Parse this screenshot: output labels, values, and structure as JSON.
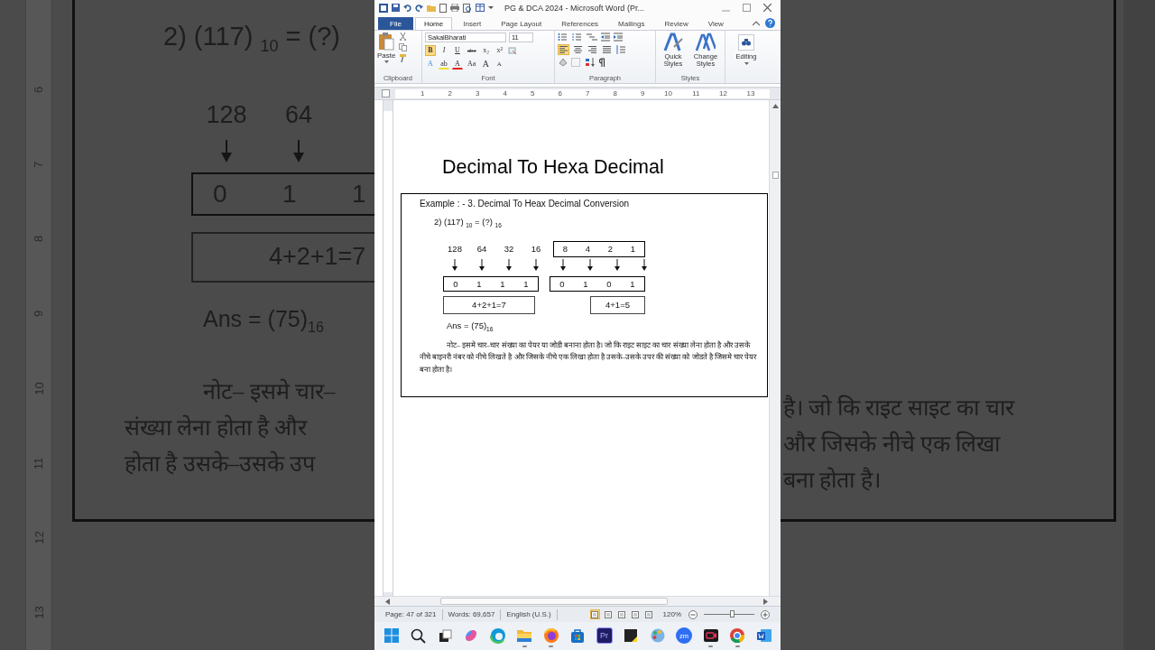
{
  "backdrop_left": {
    "ruler_labels": [
      "6",
      "7",
      "8",
      "9",
      "10",
      "11",
      "12",
      "13"
    ],
    "equation": "2)  (117) $_{10}$ = (?)",
    "weights": [
      "128",
      "64"
    ],
    "bits": [
      "0",
      "1",
      "1"
    ],
    "sum": "4+2+1=7",
    "answer": "Ans = (75)$_{16}$",
    "note_lines": [
      "नोट– इसमे चार–",
      "संख्या लेना होता है और",
      "होता है उसके–उसके उप"
    ]
  },
  "window": {
    "title": "PG & DCA 2024  -  Microsoft Word (Pr..."
  },
  "ribbon_tabs": [
    {
      "label": "File",
      "kind": "file",
      "selected": false
    },
    {
      "label": "Home",
      "kind": "tab",
      "selected": true
    },
    {
      "label": "Insert",
      "kind": "tab",
      "selected": false
    },
    {
      "label": "Page Layout",
      "kind": "tab",
      "selected": false
    },
    {
      "label": "References",
      "kind": "tab",
      "selected": false
    },
    {
      "label": "Mailings",
      "kind": "tab",
      "selected": false
    },
    {
      "label": "Review",
      "kind": "tab",
      "selected": false
    },
    {
      "label": "View",
      "kind": "tab",
      "selected": false
    }
  ],
  "ribbon": {
    "clipboard": {
      "label": "Clipboard",
      "paste": "Paste"
    },
    "font": {
      "label": "Font",
      "font_name": "SakalBharati",
      "font_size": "11",
      "tools": [
        {
          "kind": "bold",
          "label": "B",
          "on": true
        },
        {
          "kind": "italic",
          "label": "I",
          "on": false
        },
        {
          "kind": "underline",
          "label": "U",
          "on": false
        },
        {
          "kind": "strike",
          "label": "abc",
          "on": false
        },
        {
          "kind": "subscript",
          "label": "x₂",
          "on": false
        },
        {
          "kind": "superscript",
          "label": "x²",
          "on": false
        }
      ],
      "tools_row2": [
        {
          "kind": "effects",
          "label": "A"
        },
        {
          "kind": "highlight",
          "label": "ab"
        },
        {
          "kind": "color",
          "label": "A"
        },
        {
          "kind": "case",
          "label": "Aa"
        },
        {
          "kind": "grow",
          "label": "A"
        },
        {
          "kind": "shrink",
          "label": "A"
        }
      ]
    },
    "paragraph": {
      "label": "Paragraph",
      "align_buttons": [
        {
          "kind": "left",
          "selected": true
        },
        {
          "kind": "center",
          "selected": false
        },
        {
          "kind": "right",
          "selected": false
        },
        {
          "kind": "justify",
          "selected": false
        }
      ]
    },
    "styles": {
      "label": "Styles",
      "buttons": [
        "Quick Styles",
        "Change Styles"
      ]
    },
    "editing": {
      "button": "Editing"
    }
  },
  "ruler_labels": [
    "1",
    "2",
    "3",
    "4",
    "5",
    "6",
    "7",
    "8",
    "9",
    "10",
    "11",
    "12",
    "13"
  ],
  "document": {
    "title": "Decimal To Hexa Decimal",
    "heading": "Example : - 3. Decimal To Heax Decimal Conversion",
    "equation": "2)  (117) $_{10}$ = (?) $_{16}$",
    "weights": [
      "128",
      "64",
      "32",
      "16"
    ],
    "weights_boxed": [
      "8",
      "4",
      "2",
      "1"
    ],
    "bit_groups": [
      [
        "0",
        "1",
        "1",
        "1"
      ],
      [
        "0",
        "1",
        "0",
        "1"
      ]
    ],
    "sums": [
      "4+2+1=7",
      "4+1=5"
    ],
    "answer": "Ans = (75)$_{16}$",
    "note": "नोट– इसमे चार–चार संख्या का पेयर या जोडी बनाना होता है। जो कि राइट साइट का चार संख्या लेना होता है और उसके नीचे बाइनरी नंबर को नीचे लिखते है और जिसके नीचे एक लिखा होता है उसके–उसके उपर की संख्या को जोडते है जिसमे चार पेयर बना होता है।"
  },
  "status_bar": {
    "page": "Page: 47 of 321",
    "words": "Words: 69,657",
    "language": "English (U.S.)",
    "zoom": "120%",
    "zoom_slider": {
      "level": 0.55
    }
  },
  "taskbar": [
    {
      "kind": "start",
      "running": false
    },
    {
      "kind": "search",
      "running": false
    },
    {
      "kind": "taskview",
      "running": false
    },
    {
      "kind": "copilot",
      "running": false
    },
    {
      "kind": "edge",
      "running": false
    },
    {
      "kind": "folder",
      "running": true
    },
    {
      "kind": "firefox",
      "running": true
    },
    {
      "kind": "store",
      "running": false
    },
    {
      "kind": "tile",
      "label": "Pr",
      "running": false
    },
    {
      "kind": "notes",
      "running": false
    },
    {
      "kind": "paint",
      "running": false
    },
    {
      "kind": "zoom",
      "label": "zm",
      "running": false
    },
    {
      "kind": "recorder",
      "running": true
    },
    {
      "kind": "chrome",
      "running": true
    },
    {
      "kind": "word",
      "running": false
    }
  ],
  "backdrop_right": {
    "note_lines": [
      "है। जो कि राइट साइट का चार",
      "और जिसके नीचे एक लिखा",
      "बना होता है।"
    ]
  }
}
